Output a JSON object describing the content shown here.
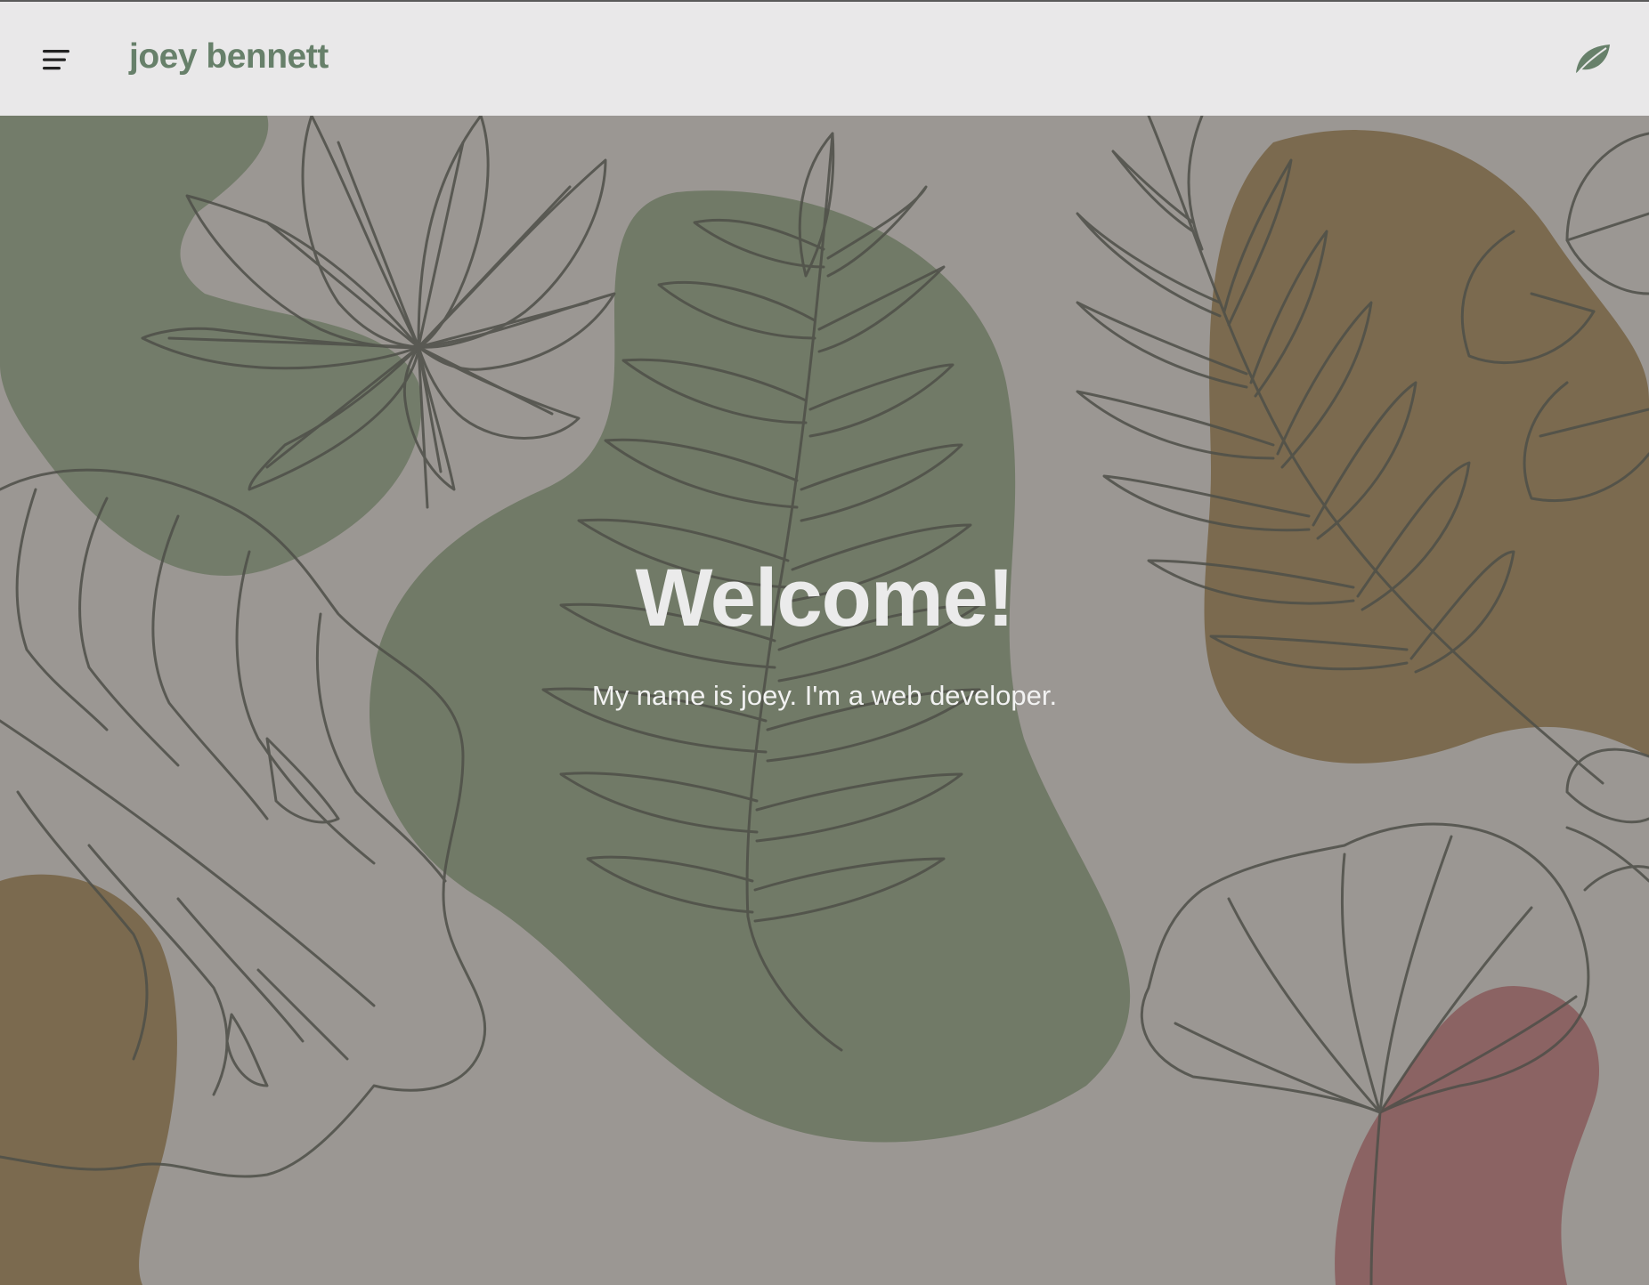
{
  "header": {
    "title": "joey bennett",
    "menu_icon": "hamburger-menu-icon",
    "brand_icon": "leaf-icon"
  },
  "hero": {
    "heading": "Welcome!",
    "subheading": "My name is joey. I'm a web developer."
  },
  "colors": {
    "appbar_bg": "#e9e8e9",
    "brand_green": "#67806a",
    "hero_bg": "#9b9793",
    "blob_green": "#717a67",
    "blob_brown": "#7b6a4f",
    "blob_red": "#8b6363",
    "line_art": "#4e4f48",
    "hero_text": "#ebebeb"
  }
}
